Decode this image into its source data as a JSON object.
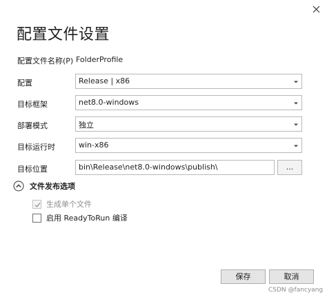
{
  "window": {
    "close_icon": "close-icon"
  },
  "dialog": {
    "title": "配置文件设置"
  },
  "profile_name": {
    "label": "配置文件名称(P)",
    "value": "FolderProfile"
  },
  "fields": {
    "configuration": {
      "label": "配置",
      "value": "Release | x86"
    },
    "target_framework": {
      "label": "目标框架",
      "value": "net8.0-windows"
    },
    "deployment_mode": {
      "label": "部署模式",
      "value": "独立"
    },
    "target_runtime": {
      "label": "目标运行时",
      "value": "win-x86"
    },
    "target_location": {
      "label": "目标位置",
      "value": "bin\\Release\\net8.0-windows\\publish\\",
      "browse_label": "..."
    }
  },
  "publish_options": {
    "header": "文件发布选项",
    "expanded": true,
    "single_file": {
      "label": "生成单个文件",
      "checked": true,
      "disabled": true
    },
    "ready_to_run": {
      "label": "启用 ReadyToRun 编译",
      "checked": false,
      "disabled": false
    }
  },
  "buttons": {
    "save": "保存",
    "cancel": "取消"
  },
  "watermark": "CSDN @fancyang",
  "colors": {
    "border": "#b8b8b8",
    "button_bg": "#e5e5e5",
    "disabled_text": "#8e8e8e"
  }
}
